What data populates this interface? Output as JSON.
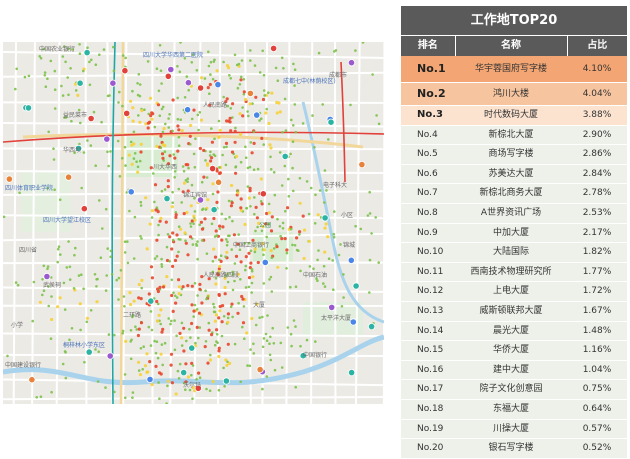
{
  "table": {
    "title": "工作地TOP20",
    "headers": [
      "排名",
      "名称",
      "占比"
    ],
    "rows": [
      {
        "rank": "No.1",
        "name": "华宇蓉国府写字楼",
        "share": "4.10%"
      },
      {
        "rank": "No.2",
        "name": "鸿川大楼",
        "share": "4.04%"
      },
      {
        "rank": "No.3",
        "name": "时代数码大厦",
        "share": "3.88%"
      },
      {
        "rank": "No.4",
        "name": "新棕北大厦",
        "share": "2.90%"
      },
      {
        "rank": "No.5",
        "name": "商场写字楼",
        "share": "2.86%"
      },
      {
        "rank": "No.6",
        "name": "苏美达大厦",
        "share": "2.84%"
      },
      {
        "rank": "No.7",
        "name": "新棕北商务大厦",
        "share": "2.78%"
      },
      {
        "rank": "No.8",
        "name": "A世界资讯广场",
        "share": "2.53%"
      },
      {
        "rank": "No.9",
        "name": "中加大厦",
        "share": "2.17%"
      },
      {
        "rank": "No.10",
        "name": "大陆国际",
        "share": "1.82%"
      },
      {
        "rank": "No.11",
        "name": "西南技术物理研究所",
        "share": "1.77%"
      },
      {
        "rank": "No.12",
        "name": "上电大厦",
        "share": "1.72%"
      },
      {
        "rank": "No.13",
        "name": "威斯顿联邦大厦",
        "share": "1.67%"
      },
      {
        "rank": "No.14",
        "name": "晨光大厦",
        "share": "1.48%"
      },
      {
        "rank": "No.15",
        "name": "华侨大厦",
        "share": "1.16%"
      },
      {
        "rank": "No.16",
        "name": "建中大厦",
        "share": "1.04%"
      },
      {
        "rank": "No.17",
        "name": "院子文化创意园",
        "share": "0.75%"
      },
      {
        "rank": "No.18",
        "name": "东福大厦",
        "share": "0.64%"
      },
      {
        "rank": "No.19",
        "name": "川操大厦",
        "share": "0.57%"
      },
      {
        "rank": "No.20",
        "name": "银石写字楼",
        "share": "0.52%"
      }
    ]
  },
  "map": {
    "labels": {
      "l1": "中国农业银行",
      "l2": "四川大学华西第二医院",
      "l3": "成都七中(林荫校区)",
      "l4": "人民南路",
      "l5": "四川体育职业学院",
      "l6": "四川大学望江校区",
      "l7": "益民菜市",
      "l8": "电子科大",
      "l9": "川大华西",
      "l10": "中国工商银行",
      "l11": "小区",
      "l12": "华西坝",
      "l13": "四川省",
      "l14": "锦江宾馆",
      "l15": "武侯祠",
      "l16": "中国石油",
      "l17": "人民南路四段",
      "l18": "太平洋大厦",
      "l19": "桐梓林小学东区",
      "l20": "中国银行",
      "l21": "沃尔玛",
      "l22": "二环路",
      "l23": "小学",
      "l24": "锦城",
      "l25": "大厦",
      "l26": "公园",
      "l27": "成都市",
      "l28": "中国建设银行"
    },
    "colors": {
      "low": "#7cc24a",
      "mid": "#f6d23a",
      "high": "#e8462c",
      "river": "#a9d3ec",
      "metro_red": "#e2403a",
      "metro_teal": "#1ea7a5",
      "park": "#cfe8c7"
    }
  }
}
